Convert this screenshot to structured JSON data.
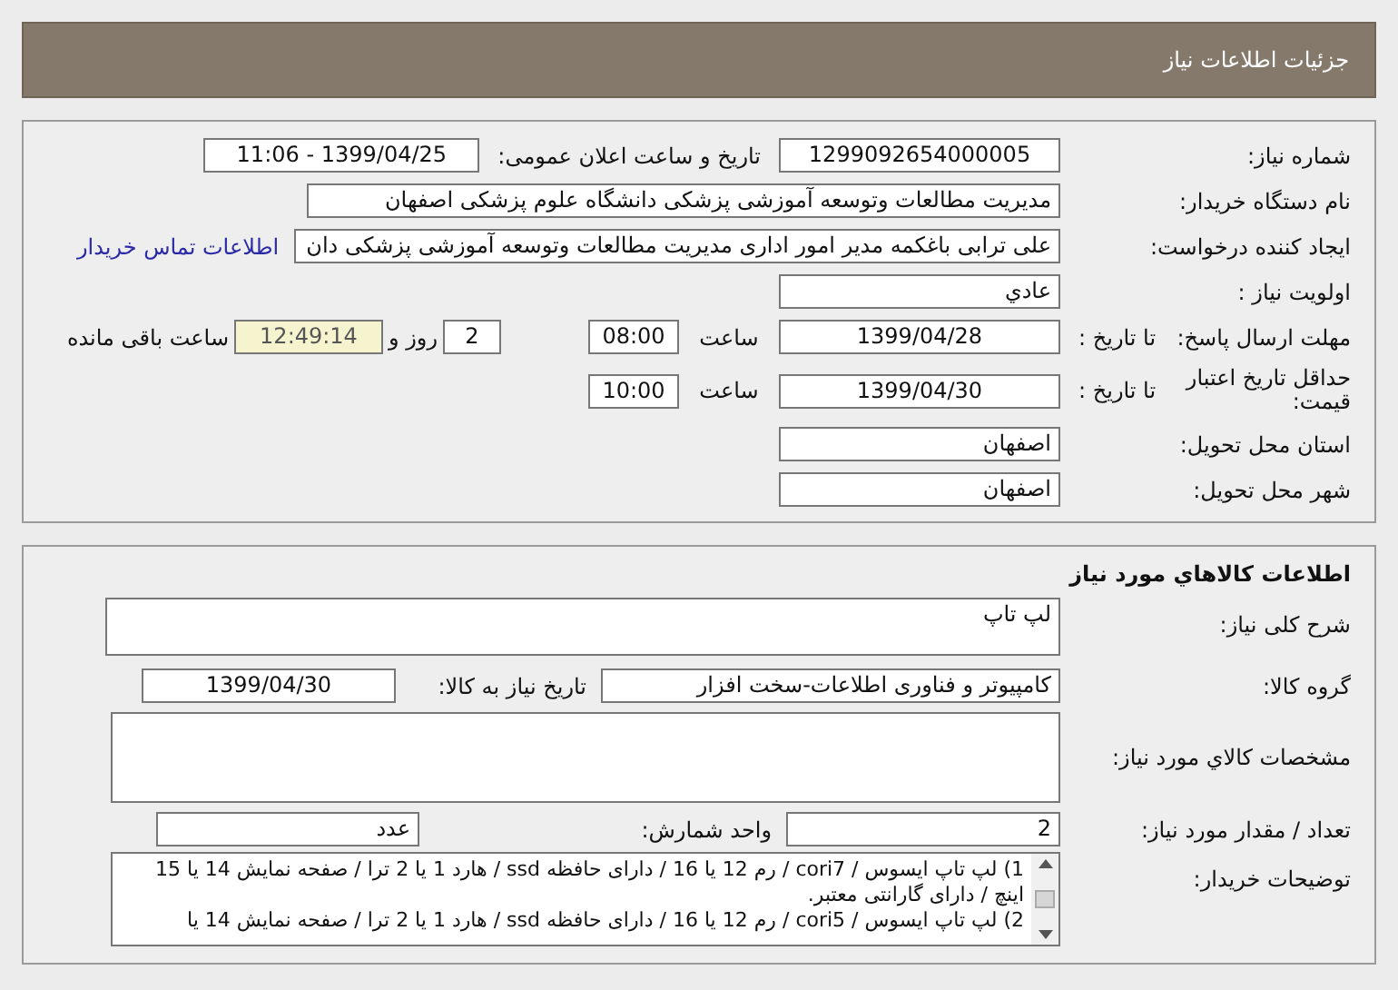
{
  "header": {
    "title": "جزئیات اطلاعات نیاز"
  },
  "need_info": {
    "need_number": {
      "label": "شماره نیاز:",
      "value": "1299092654000005"
    },
    "announce": {
      "label": "تاریخ و ساعت اعلان عمومی:",
      "value": "1399/04/25 - 11:06"
    },
    "buyer_org": {
      "label": "نام دستگاه خریدار:",
      "value": "مدیریت مطالعات وتوسعه آموزشی پزشکی دانشگاه علوم پزشکی اصفهان"
    },
    "requester": {
      "label": "ایجاد کننده درخواست:",
      "value": "علی ترابی باغکمه مدیر امور اداری مدیریت مطالعات وتوسعه آموزشی پزشکی دان",
      "contact_link": "اطلاعات تماس خریدار"
    },
    "priority": {
      "label": "اولویت نیاز :",
      "value": "عادي"
    },
    "deadline": {
      "label": "مهلت ارسال پاسخ:",
      "date_label": "تا تاریخ :",
      "date": "1399/04/28",
      "time_label": "ساعت",
      "time": "08:00",
      "days": "2",
      "days_label": "روز و",
      "remaining": "12:49:14",
      "remaining_label": "ساعت باقی مانده"
    },
    "price_validity": {
      "label": "حداقل تاریخ اعتبار قیمت:",
      "date_label": "تا تاریخ :",
      "date": "1399/04/30",
      "time_label": "ساعت",
      "time": "10:00"
    },
    "province": {
      "label": "استان محل تحویل:",
      "value": "اصفهان"
    },
    "city": {
      "label": "شهر محل تحویل:",
      "value": "اصفهان"
    }
  },
  "goods": {
    "title": "اطلاعات کالاهاي مورد نیاز",
    "summary": {
      "label": "شرح کلی نیاز:",
      "value": "لپ تاپ"
    },
    "group": {
      "label": "گروه کالا:",
      "value": "کامپیوتر و فناوری اطلاعات-سخت افزار",
      "need_date_label": "تاریخ نیاز به کالا:",
      "need_date": "1399/04/30"
    },
    "specs": {
      "label": "مشخصات کالاي مورد نیاز:"
    },
    "quantity": {
      "label": "تعداد / مقدار مورد نیاز:",
      "value": "2",
      "unit_label": "واحد شمارش:",
      "unit": "عدد"
    },
    "buyer_notes": {
      "label": "توضیحات خریدار:",
      "text": "1) لپ تاپ ایسوس / cori7 / رم 12 یا 16 / دارای حافظه ssd / هارد 1 یا 2 ترا / صفحه نمایش 14 یا 15 اینچ / دارای گارانتی معتبر.\n2) لپ تاپ ایسوس / cori5 / رم 12 یا 16 / دارای حافظه ssd / هارد 1 یا 2 ترا / صفحه نمایش 14 یا"
    }
  }
}
